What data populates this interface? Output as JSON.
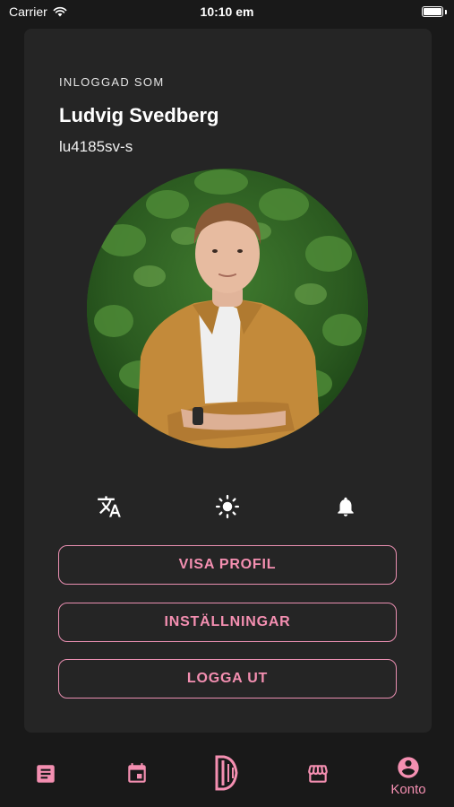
{
  "status_bar": {
    "carrier": "Carrier",
    "time": "10:10 em"
  },
  "profile": {
    "logged_in_label": "INLOGGAD SOM",
    "name": "Ludvig Svedberg",
    "user_id": "lu4185sv-s"
  },
  "quick_actions": [
    {
      "icon": "translate-icon"
    },
    {
      "icon": "brightness-icon"
    },
    {
      "icon": "bell-icon"
    }
  ],
  "buttons": {
    "view_profile": "VISA PROFIL",
    "settings": "INSTÄLLNINGAR",
    "logout": "LOGGA UT"
  },
  "tab_bar": {
    "tabs": [
      {
        "icon": "article-icon",
        "label": ""
      },
      {
        "icon": "calendar-icon",
        "label": ""
      },
      {
        "icon": "logo-icon",
        "label": ""
      },
      {
        "icon": "store-icon",
        "label": ""
      },
      {
        "icon": "account-circle-icon",
        "label": "Konto"
      }
    ],
    "active": "Konto"
  },
  "colors": {
    "background": "#191919",
    "card": "#252525",
    "accent": "#f48fb1",
    "text": "#ffffff"
  }
}
